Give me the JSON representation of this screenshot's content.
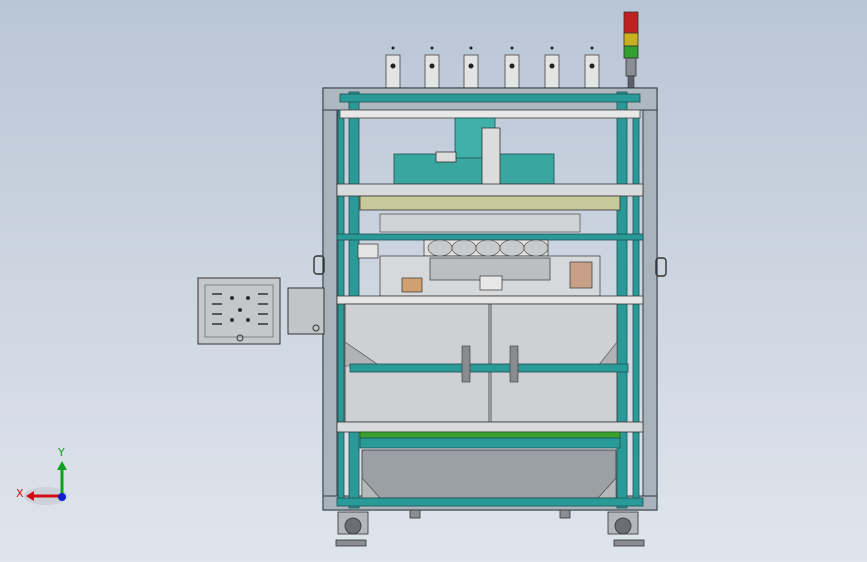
{
  "viewport": {
    "background_top": "#b9c6d6",
    "background_bottom": "#dfe5ec"
  },
  "triad": {
    "x_label": "X",
    "y_label": "Y",
    "x_color": "#d01010",
    "y_color": "#10a020",
    "z_color": "#1020d0"
  },
  "colors": {
    "frame_teal": "#2a9a98",
    "frame_dark": "#2d3a44",
    "panel_grey": "#cfd0d2",
    "bed_green": "#3aa030",
    "rail_khaki": "#c8c89a",
    "stack_red": "#c02020",
    "stack_yellow": "#c8b020",
    "stack_green": "#30a030"
  }
}
